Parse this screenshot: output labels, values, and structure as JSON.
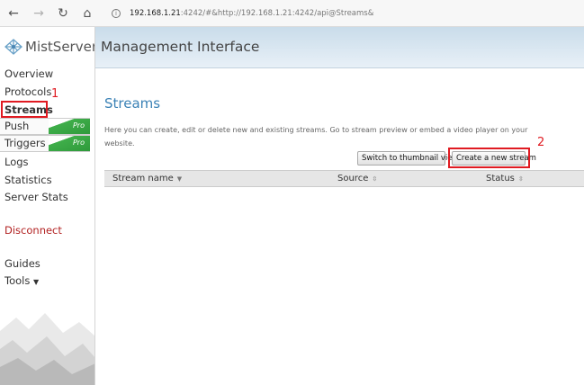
{
  "browser": {
    "back_icon": "arrow-left-icon",
    "forward_icon": "arrow-right-icon",
    "reload_icon": "reload-icon",
    "home_icon": "home-icon",
    "url_host": "192.168.1.21",
    "url_rest": ":4242/#&http://192.168.1.21:4242/api@Streams&"
  },
  "sidebar": {
    "logo_text": "MistServer",
    "items": [
      {
        "label": "Overview"
      },
      {
        "label": "Protocols"
      },
      {
        "label": "Streams"
      },
      {
        "label": "Push",
        "badge": "Pro"
      },
      {
        "label": "Triggers",
        "badge": "Pro"
      },
      {
        "label": "Logs"
      },
      {
        "label": "Statistics"
      },
      {
        "label": "Server Stats"
      }
    ],
    "disconnect": "Disconnect",
    "guides": "Guides",
    "tools": "Tools"
  },
  "header": {
    "title": "Management Interface"
  },
  "main": {
    "title": "Streams",
    "description": "Here you can create, edit or delete new and existing streams. Go to stream preview or embed a video player on your website.",
    "switch_button": "Switch to thumbnail view",
    "create_button": "Create a new stream",
    "columns": [
      "Stream name",
      "Source",
      "Status"
    ]
  },
  "annotations": {
    "one": "1",
    "two": "2"
  },
  "colors": {
    "accent": "#3b82b6",
    "annotation": "#e01b22",
    "pro_badge": "#3fae4a",
    "disconnect": "#b22222"
  }
}
